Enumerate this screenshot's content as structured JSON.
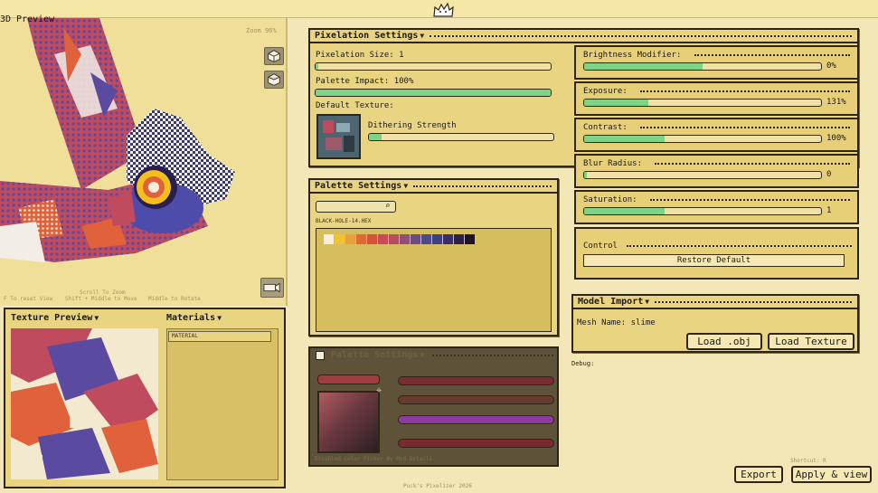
{
  "topbar": {
    "mascot_icon": "cat-mascot-icon"
  },
  "preview": {
    "title": "3D Preview",
    "zoom": "Zoom 96%",
    "hint_zoom": "Scroll To Zoom",
    "hint_reset": "F To reset View",
    "hint_move": "Shift + Middle to Move",
    "hint_rotate": "Middle to Rotate"
  },
  "texture_preview": {
    "title": "Texture Preview"
  },
  "materials": {
    "title": "Materials",
    "items": [
      "MATERIAL"
    ]
  },
  "pixelation": {
    "title": "Pixelation Settings",
    "size_label": "Pixelation Size: 1",
    "size_fill": 0.0,
    "palette_impact_label": "Palette Impact: 100%",
    "palette_impact_fill": 1.0,
    "default_texture_label": "Default Texture:",
    "dithering_label": "Dithering Strength",
    "dithering_fill": 0.07
  },
  "adjustments": [
    {
      "label": "Brightness Modifier:",
      "value": "0%",
      "fill": 0.5
    },
    {
      "label": "Exposure:",
      "value": "131%",
      "fill": 0.27
    },
    {
      "label": "Contrast:",
      "value": "100%",
      "fill": 0.34
    },
    {
      "label": "Blur Radius:",
      "value": "0",
      "fill": 0.0
    },
    {
      "label": "Saturation:",
      "value": "1",
      "fill": 0.34
    }
  ],
  "palette": {
    "title": "Palette Settings",
    "search_placeholder": "",
    "palette_name": "BLACK-HOLE-14.HEX",
    "swatches": [
      "#f6eed8",
      "#f1c232",
      "#e8a13a",
      "#e06a32",
      "#d4523a",
      "#c84a56",
      "#b24d62",
      "#8e4f78",
      "#6b4c82",
      "#4f4a8a",
      "#3f3f86",
      "#3a2e6a",
      "#2e2046",
      "#1d1424"
    ]
  },
  "palette_editor": {
    "title": "Palette Settings",
    "caption": "Disabled Color Picker By Mod Details",
    "chip_colors": [
      "#a23b3f",
      "#5a2e33"
    ],
    "bar_colors": [
      "#7a2c34",
      "#6b3a2f",
      "#8e3aa0",
      "#7a2a30"
    ]
  },
  "control": {
    "title": "Control",
    "restore_label": "Restore Default"
  },
  "model_import": {
    "title": "Model Import",
    "mesh_name": "Mesh Name: slime",
    "load_obj": "Load .obj",
    "load_texture": "Load Texture"
  },
  "debug": {
    "label": "Debug:"
  },
  "actions": {
    "shortcut": "Shortcut: R",
    "export": "Export",
    "apply": "Apply & view"
  },
  "footer": {
    "text": "Puck's Pixelizer 2026"
  },
  "colors": {
    "background": "#f3e7b8",
    "panel": "#e9d482",
    "accent_green": "#7fd387",
    "border": "#2d2618"
  }
}
